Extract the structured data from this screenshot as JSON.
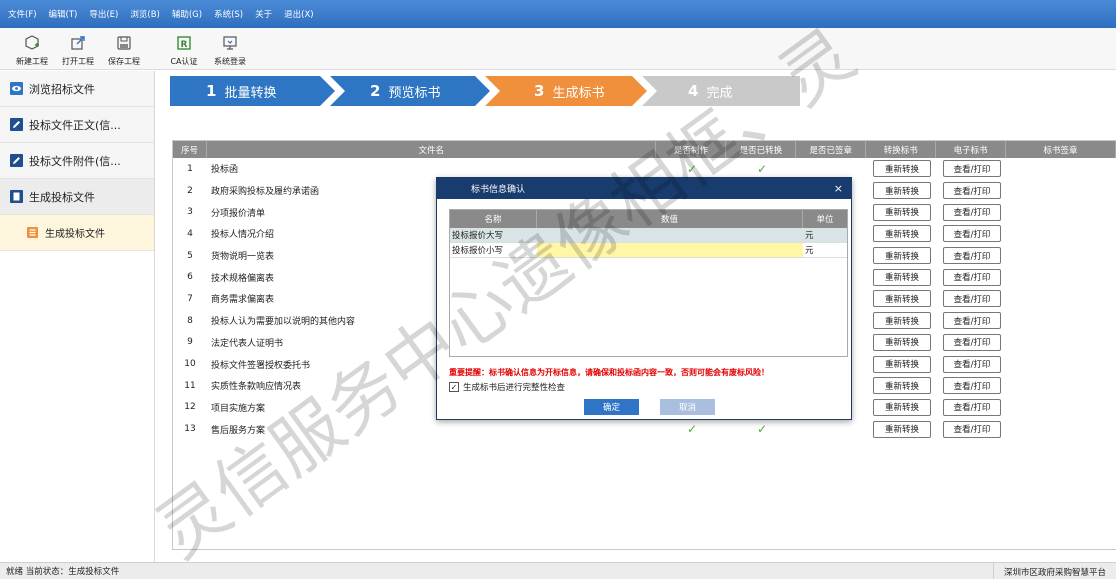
{
  "menu": [
    "文件(F)",
    "编辑(T)",
    "导出(E)",
    "浏览(B)",
    "辅助(G)",
    "系统(S)",
    "关于",
    "退出(X)"
  ],
  "toolbar": [
    {
      "label": "新建工程",
      "icon": "new-project-icon"
    },
    {
      "label": "打开工程",
      "icon": "open-project-icon"
    },
    {
      "label": "保存工程",
      "icon": "save-project-icon"
    },
    {
      "label": "CA认证",
      "icon": "ca-auth-icon"
    },
    {
      "label": "系统登录",
      "icon": "system-login-icon"
    }
  ],
  "sidebar": [
    {
      "label": "浏览招标文件",
      "icon": "eye-icon"
    },
    {
      "label": "投标文件正文(信...",
      "icon": "edit-icon"
    },
    {
      "label": "投标文件附件(信...",
      "icon": "edit-icon"
    },
    {
      "label": "生成投标文件",
      "icon": "document-icon"
    },
    {
      "label": "生成投标文件",
      "icon": "list-icon"
    }
  ],
  "steps": [
    {
      "num": "1",
      "label": "批量转换",
      "color": "#2e75c3"
    },
    {
      "num": "2",
      "label": "预览标书",
      "color": "#2e75c3"
    },
    {
      "num": "3",
      "label": "生成标书",
      "color": "#f0903c"
    },
    {
      "num": "4",
      "label": "完成",
      "color": "#c9c9c9"
    }
  ],
  "table": {
    "headers": [
      "序号",
      "文件名",
      "是否制作",
      "是否已转换",
      "是否已签章",
      "转换标书",
      "电子标书",
      "标书签章"
    ],
    "convert_label": "重新转换",
    "view_label": "查看/打印",
    "check_mark": "✓",
    "rows": [
      {
        "no": "1",
        "name": "投标函",
        "made": true,
        "converted": true
      },
      {
        "no": "2",
        "name": "政府采购投标及履约承诺函",
        "made": false,
        "converted": false
      },
      {
        "no": "3",
        "name": "分项报价清单",
        "made": false,
        "converted": false
      },
      {
        "no": "4",
        "name": "投标人情况介绍",
        "made": false,
        "converted": false
      },
      {
        "no": "5",
        "name": "货物说明一览表",
        "made": false,
        "converted": false
      },
      {
        "no": "6",
        "name": "技术规格偏离表",
        "made": false,
        "converted": false
      },
      {
        "no": "7",
        "name": "商务需求偏离表",
        "made": false,
        "converted": false
      },
      {
        "no": "8",
        "name": "投标人认为需要加以说明的其他内容",
        "made": false,
        "converted": false
      },
      {
        "no": "9",
        "name": "法定代表人证明书",
        "made": false,
        "converted": false
      },
      {
        "no": "10",
        "name": "投标文件签署授权委托书",
        "made": false,
        "converted": false
      },
      {
        "no": "11",
        "name": "实质性条款响应情况表",
        "made": false,
        "converted": false
      },
      {
        "no": "12",
        "name": "项目实施方案",
        "made": false,
        "converted": false
      },
      {
        "no": "13",
        "name": "售后服务方案",
        "made": true,
        "converted": true
      }
    ]
  },
  "dialog": {
    "title": "标书信息确认",
    "close": "×",
    "headers": [
      "名称",
      "数值",
      "单位"
    ],
    "rows": [
      {
        "name": "投标报价大写",
        "value": "",
        "unit": "元"
      },
      {
        "name": "投标报价小写",
        "value": "",
        "unit": "元"
      }
    ],
    "warning": "重要提醒：标书确认信息为开标信息，请确保和投标函内容一致，否则可能会有废标风险！",
    "checkbox_label": "生成标书后进行完整性检查",
    "checkbox_checked": true,
    "check_glyph": "✓",
    "ok": "确定",
    "cancel": "取消"
  },
  "status": {
    "left": "就绪  当前状态：生成投标文件",
    "right": "深圳市区政府采购智慧平台"
  },
  "watermark": "灵信服务中心遗像相框、灵"
}
